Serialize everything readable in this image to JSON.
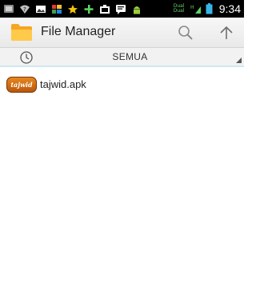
{
  "status_bar": {
    "time": "9:34",
    "notification_icons": [
      "screenshot-icon",
      "wifi-question-icon",
      "image-icon",
      "app-icon",
      "star-icon",
      "plus-icon",
      "briefcase-icon",
      "chat-icon",
      "android-icon"
    ],
    "carrier_text_line1": "Dual",
    "carrier_text_line2": "Dual",
    "network_label": "H"
  },
  "action_bar": {
    "title": "File Manager",
    "search_icon": "search-icon",
    "up_icon": "arrow-up-icon"
  },
  "filter": {
    "clock_icon": "clock-icon",
    "selected": "SEMUA"
  },
  "files": [
    {
      "thumb_label": "tajwid",
      "name": "tajwid.apk"
    }
  ],
  "colors": {
    "status_bar_bg": "#000000",
    "action_bar_bg": "#f0f0f0",
    "accent_line": "#cfe8f1",
    "file_thumb": "#d9731a"
  }
}
